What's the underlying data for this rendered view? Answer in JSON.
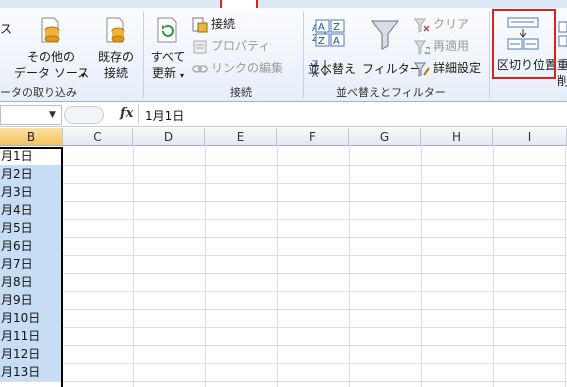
{
  "ribbon": {
    "partial_left_label": "ス",
    "other_sources_label": "その他の",
    "other_sources_label2": "データ ソース",
    "existing_conn_label": "既存の",
    "existing_conn_label2": "接続",
    "refresh_all_label": "すべて",
    "refresh_all_label2": "更新",
    "connections_label": "接続",
    "properties_label": "プロパティ",
    "edit_links_label": "リンクの編集",
    "sort_label": "並べ替え",
    "filter_label": "フィルター",
    "clear_label": "クリア",
    "reapply_label": "再適用",
    "advanced_label": "詳細設定",
    "text_to_columns_label": "区切り位置",
    "partial_right_label": "重",
    "partial_right_label2": "削",
    "group_external": "ータの取り込み",
    "group_connections": "接続",
    "group_sort_filter": "並べ替えとフィルター"
  },
  "formula_bar": {
    "fx": "fx",
    "value": "1月1日"
  },
  "columns": [
    "B",
    "C",
    "D",
    "E",
    "F",
    "G",
    "H",
    "I"
  ],
  "cells_b": [
    "月1日",
    "月2日",
    "月3日",
    "月4日",
    "月5日",
    "月6日",
    "月7日",
    "月8日",
    "月9日",
    "月10日",
    "月11日",
    "月12日",
    "月13日"
  ],
  "colors": {
    "selection_fill": "#c6ddf4",
    "highlight_red": "#d9241c",
    "header_selected": "#f5c35a"
  }
}
